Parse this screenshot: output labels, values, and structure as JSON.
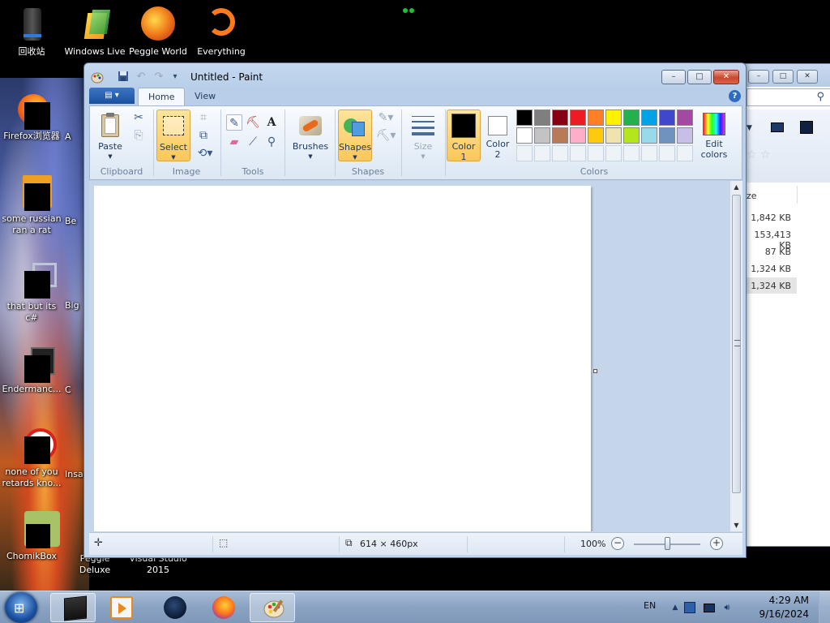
{
  "desktop": {
    "top_icons": [
      {
        "label": "回收站",
        "icon": "recycle-bin-icon"
      },
      {
        "label": "Windows Live",
        "icon": "windows-live-icon"
      },
      {
        "label": "Peggle World",
        "icon": "peggle-icon"
      },
      {
        "label": "Everything",
        "icon": "everything-search-icon"
      }
    ],
    "left_icons": [
      {
        "label": "Firefox浏览器",
        "icon": "firefox-icon"
      },
      {
        "label": "some russian ran a rat",
        "icon": "java-icon"
      },
      {
        "label": "that but its c#",
        "icon": "shortcut-icon"
      },
      {
        "label": "Endermanc...",
        "icon": "shortcut-icon"
      },
      {
        "label": "none of you retards kno...",
        "icon": "shortcut-icon"
      },
      {
        "label": "ChomikBox",
        "icon": "chomikbox-icon"
      }
    ],
    "partial_labels": [
      "A",
      "Be",
      "Big",
      "C",
      "Insa",
      "Peggle Deluxe",
      "Visual Studio 2015"
    ]
  },
  "paint": {
    "title": "Untitled - Paint",
    "app_menu_label": "▤ ▾",
    "tabs": [
      {
        "label": "Home",
        "active": true
      },
      {
        "label": "View",
        "active": false
      }
    ],
    "caption_buttons": {
      "minimize": "–",
      "maximize": "□",
      "close": "✕"
    },
    "groups": {
      "clipboard": {
        "label": "Clipboard",
        "paste": "Paste"
      },
      "image": {
        "label": "Image",
        "select": "Select"
      },
      "tools": {
        "label": "Tools"
      },
      "brushes": {
        "label": "Brushes"
      },
      "shapes": {
        "label": "Shapes",
        "shapes_btn": "Shapes"
      },
      "size": {
        "label": "Size"
      },
      "colors": {
        "label": "Colors",
        "color1": "Color 1",
        "color2": "Color 2",
        "edit_colors": "Edit colors",
        "color1_value": "#000000",
        "color2_value": "#ffffff",
        "palette_row1": [
          "#000000",
          "#7f7f7f",
          "#880015",
          "#ed1c24",
          "#ff7f27",
          "#fff200",
          "#22b14c",
          "#00a2e8",
          "#3f48cc",
          "#a349a4"
        ],
        "palette_row2": [
          "#ffffff",
          "#c3c3c3",
          "#b97a57",
          "#ffaec9",
          "#ffc90e",
          "#efe4b0",
          "#b5e61d",
          "#99d9ea",
          "#7092be",
          "#c8bfe7"
        ]
      }
    },
    "status": {
      "canvas_size": "614 × 460px",
      "zoom": "100%",
      "zoom_level": 1.0
    }
  },
  "explorer": {
    "size_header": "ze",
    "sizes": [
      "1,842 KB",
      "153,413 KB",
      "87 KB",
      "1,324 KB",
      "1,324 KB"
    ]
  },
  "taskbar": {
    "items": [
      "explorer-window",
      "media-player",
      "steam",
      "firefox",
      "paint"
    ],
    "language": "EN",
    "time": "4:29 AM",
    "date": "9/16/2024"
  }
}
